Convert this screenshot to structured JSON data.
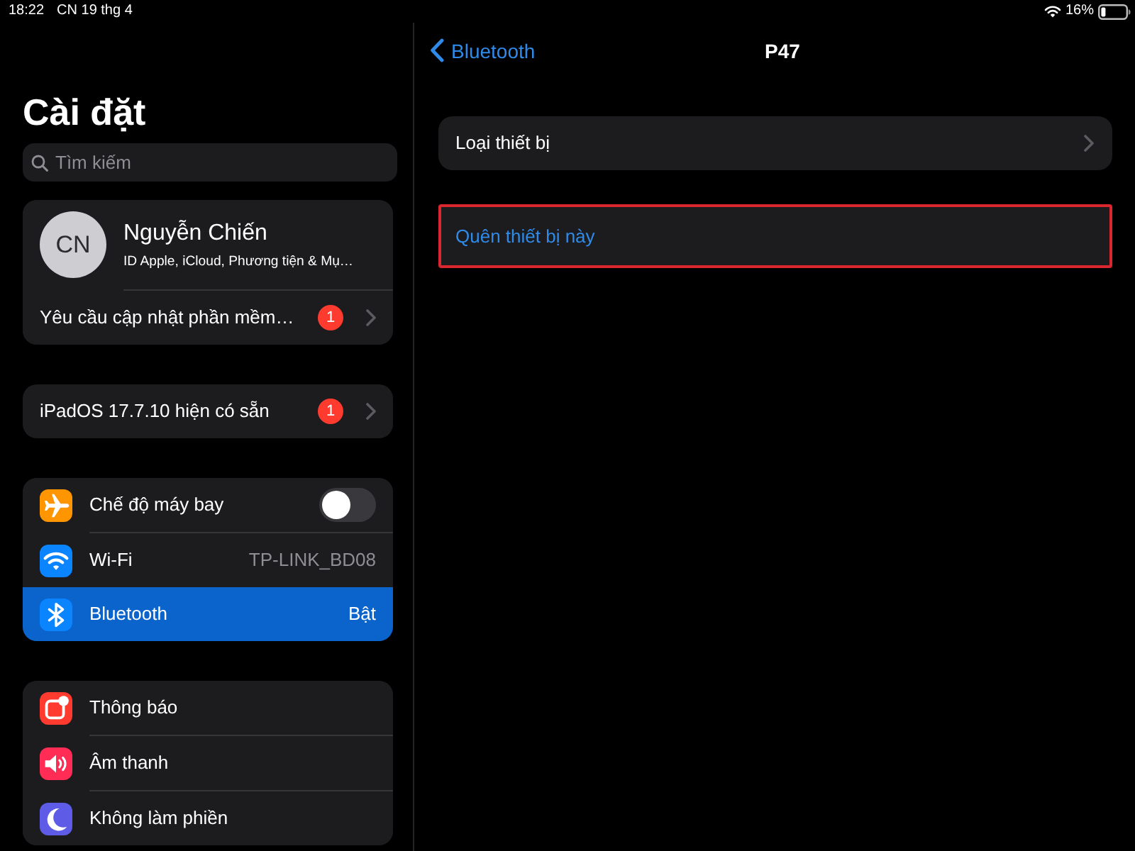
{
  "status_bar": {
    "time": "18:22",
    "date": "CN 19 thg 4",
    "battery": "16%"
  },
  "sidebar": {
    "title": "Cài đặt",
    "search": {
      "placeholder": "Tìm kiếm"
    },
    "account": {
      "initials": "CN",
      "name": "Nguyễn Chiến",
      "subtitle": "ID Apple, iCloud, Phương tiện & Mụ…",
      "selected": false,
      "rows": [
        {
          "kind": "badge",
          "label": "Yêu cầu cập nhật phần mềm…",
          "badge": "1",
          "selected": false
        }
      ]
    },
    "groups": [
      {
        "rows": [
          {
            "kind": "badge",
            "label": "iPadOS 17.7.10 hiện có sẵn",
            "badge": "1",
            "selected": false
          }
        ]
      },
      {
        "rows": [
          {
            "kind": "toggle",
            "label": "Chế độ máy bay",
            "color": "#ff9500",
            "on": false,
            "selected": false
          },
          {
            "kind": "value",
            "label": "Wi-Fi",
            "color": "#0a84ff",
            "value": "TP-LINK_BD08",
            "selected": false
          },
          {
            "kind": "value",
            "label": "Bluetooth",
            "color": "#0a84ff",
            "value": "Bật",
            "selected": true
          }
        ]
      },
      {
        "rows": [
          {
            "kind": "plain",
            "label": "Thông báo",
            "color": "#ff3b30",
            "selected": false
          },
          {
            "kind": "plain",
            "label": "Âm thanh",
            "color": "#ff2d55",
            "selected": false
          },
          {
            "kind": "plain",
            "label": "Không làm phiền",
            "color": "#5e5ce6",
            "selected": false
          }
        ]
      }
    ]
  },
  "detail": {
    "back": "Bluetooth",
    "title": "P47",
    "rows": [
      {
        "kind": "link",
        "label": "Loại thiết bị",
        "highlighted": false
      },
      {
        "kind": "action",
        "label": "Quên thiết bị này",
        "highlighted": true
      }
    ]
  }
}
